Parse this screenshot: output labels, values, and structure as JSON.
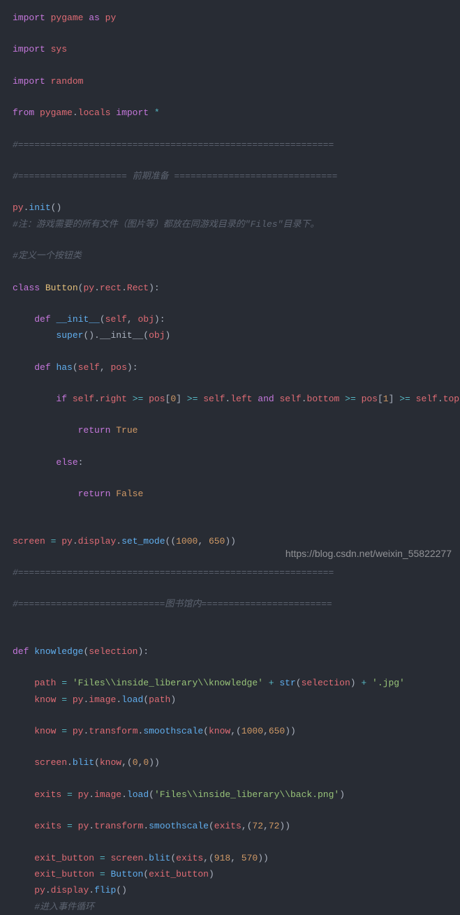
{
  "code": {
    "l1": {
      "import": "import",
      "pygame": "pygame",
      "as": "as",
      "py": "py"
    },
    "l2": {
      "import": "import",
      "sys": "sys"
    },
    "l3": {
      "import": "import",
      "random": "random"
    },
    "l4": {
      "from": "from",
      "pygame": "pygame",
      "locals": "locals",
      "import": "import",
      "star": "*"
    },
    "l5": "#==========================================================",
    "l6": "#==================== 前期准备 ==============================",
    "l7": {
      "py": "py",
      "init": "init",
      "parens": "()"
    },
    "l8": "#注：游戏需要的所有文件（图片等）都放在同游戏目录的\"Files\"目录下。",
    "l9": "#定义一个按钮类",
    "l10": {
      "class": "class",
      "Button": "Button",
      "py": "py",
      "rect": "rect",
      "Rect": "Rect"
    },
    "l11": {
      "def": "def",
      "init": "__init__",
      "self": "self",
      "obj": "obj"
    },
    "l12": {
      "super": "super",
      "obj": "obj",
      "init": ".__init__("
    },
    "l13": {
      "def": "def",
      "has": "has",
      "self": "self",
      "pos": "pos"
    },
    "l14": {
      "if": "if",
      "self": "self",
      "right": "right",
      "pos": "pos",
      "zero": "0",
      "left": "left",
      "and": "and",
      "bottom": "bottom",
      "one": "1",
      "top": "top"
    },
    "l15": {
      "return": "return",
      "True": "True"
    },
    "l16": {
      "else": "else"
    },
    "l17": {
      "return": "return",
      "False": "False"
    },
    "l18": {
      "screen": "screen",
      "py": "py",
      "display": "display",
      "set_mode": "set_mode",
      "n1": "1000",
      "n2": "650"
    },
    "l19": "#==========================================================",
    "l20": "#===========================图书馆内========================",
    "l21": {
      "def": "def",
      "knowledge": "knowledge",
      "selection": "selection"
    },
    "l22": {
      "path": "path",
      "str1": "'Files\\\\inside_liberary\\\\knowledge'",
      "str_fn": "str",
      "selection": "selection",
      "str2": "'.jpg'"
    },
    "l23": {
      "know": "know",
      "py": "py",
      "image": "image",
      "load": "load",
      "path": "path"
    },
    "l24": {
      "know": "know",
      "py": "py",
      "transform": "transform",
      "smoothscale": "smoothscale",
      "n1": "1000",
      "n2": "650"
    },
    "l25": {
      "screen": "screen",
      "blit": "blit",
      "know": "know",
      "z1": "0",
      "z2": "0"
    },
    "l26": {
      "exits": "exits",
      "py": "py",
      "image": "image",
      "load": "load",
      "str": "'Files\\\\inside_liberary\\\\back.png'"
    },
    "l27": {
      "exits": "exits",
      "py": "py",
      "transform": "transform",
      "smoothscale": "smoothscale",
      "n1": "72",
      "n2": "72"
    },
    "l28": {
      "exit_button": "exit_button",
      "screen": "screen",
      "blit": "blit",
      "exits": "exits",
      "n1": "918",
      "n2": "570"
    },
    "l29": {
      "exit_button": "exit_button",
      "Button": "Button"
    },
    "l30": {
      "py": "py",
      "display": "display",
      "flip": "flip"
    },
    "l31": "#进入事件循环"
  },
  "watermark": "https://blog.csdn.net/weixin_55822277"
}
